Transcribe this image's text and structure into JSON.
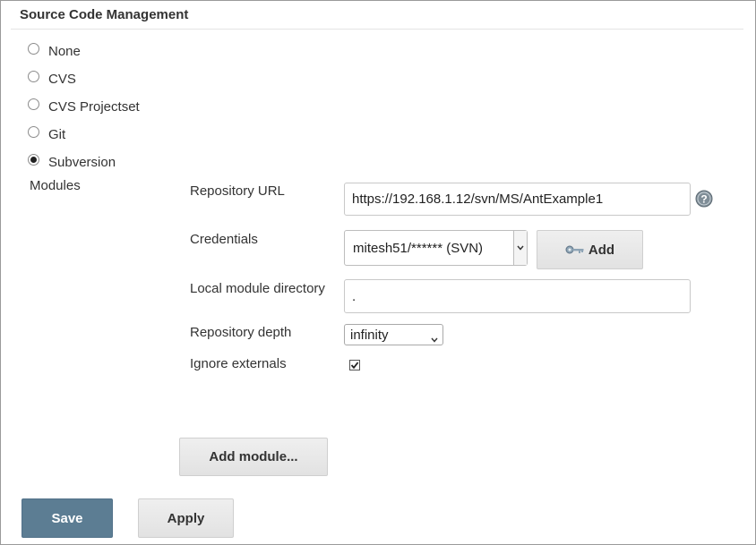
{
  "section": {
    "title": "Source Code Management"
  },
  "scm_options": [
    {
      "label": "None",
      "selected": false
    },
    {
      "label": "CVS",
      "selected": false
    },
    {
      "label": "CVS Projectset",
      "selected": false
    },
    {
      "label": "Git",
      "selected": false
    },
    {
      "label": "Subversion",
      "selected": true
    }
  ],
  "modules": {
    "label": "Modules",
    "repository_url": {
      "label": "Repository URL",
      "value": "https://192.168.1.12/svn/MS/AntExample1",
      "help_icon": "question-circle-icon"
    },
    "credentials": {
      "label": "Credentials",
      "selected": "mitesh51/****** (SVN)",
      "add_button": "Add",
      "add_icon": "key-icon"
    },
    "local_module_directory": {
      "label": "Local module directory",
      "value": "."
    },
    "repository_depth": {
      "label": "Repository depth",
      "selected": "infinity"
    },
    "ignore_externals": {
      "label": "Ignore externals",
      "checked": true
    },
    "add_module_button": "Add module..."
  },
  "actions": {
    "save_label": "Save",
    "apply_label": "Apply"
  },
  "colors": {
    "save_button": "#5c7d93",
    "help_icon": "#7f8d97"
  }
}
